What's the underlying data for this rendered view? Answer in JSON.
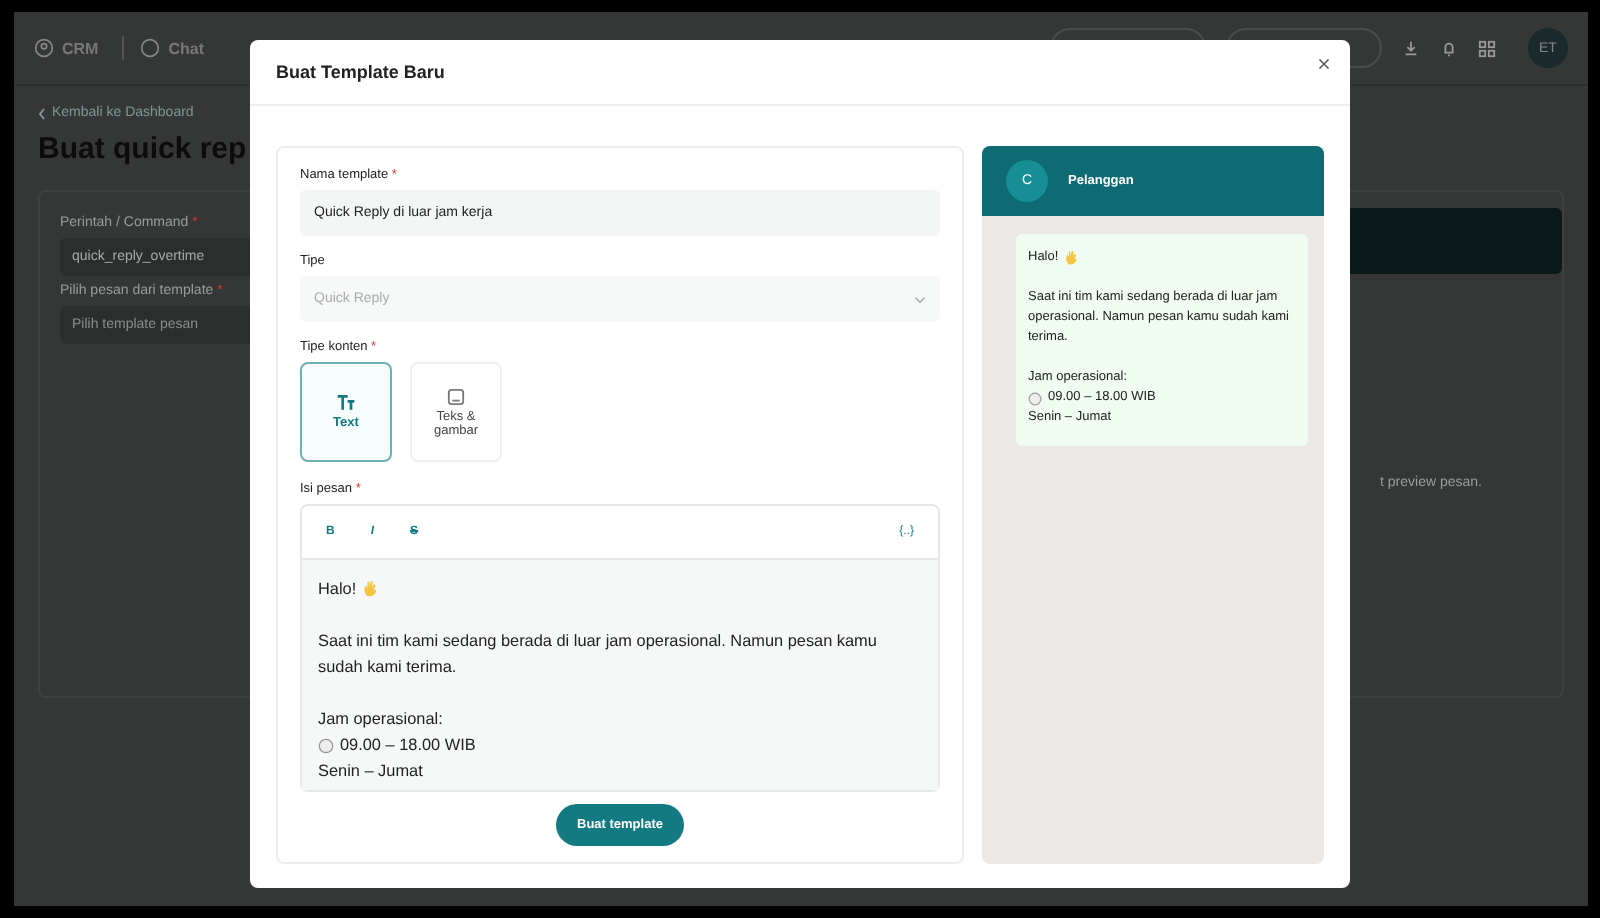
{
  "background": {
    "header": {
      "logos": [
        "CRM",
        "Chat"
      ],
      "avatar": "ET"
    },
    "back_link": "Kembali ke Dashboard",
    "title": "Buat quick rep",
    "fields": [
      {
        "label": "Perintah / Command",
        "required_mark": "*",
        "value": "quick_reply_overtime"
      },
      {
        "label": "Pilih pesan dari template",
        "required_mark": "*",
        "placeholder": "Pilih template pesan"
      }
    ],
    "preview_hint": "t preview pesan."
  },
  "modal": {
    "title": "Buat Template Baru",
    "name_field": {
      "label": "Nama template",
      "required_mark": "*",
      "value": "Quick Reply di luar jam kerja"
    },
    "type_field": {
      "label": "Tipe",
      "placeholder": "Quick Reply",
      "disabled": true
    },
    "content_type": {
      "label": "Tipe konten",
      "required_mark": "*",
      "options": [
        {
          "kind": "text",
          "label": "Text",
          "selected": true
        },
        {
          "kind": "image",
          "label": "Teks & gambar",
          "selected": false
        }
      ]
    },
    "message": {
      "label": "Isi pesan",
      "required_mark": "*",
      "toolbar": [
        {
          "kind": "bold",
          "label": "B"
        },
        {
          "kind": "italic",
          "label": "I"
        },
        {
          "kind": "strike",
          "label": "S"
        },
        {
          "kind": "variable",
          "label": "{..}"
        }
      ],
      "paragraphs": [
        [
          {
            "kind": "wave",
            "text": "Halo!"
          }
        ],
        [
          {
            "kind": "plain",
            "text": "Saat ini tim kami sedang berada di luar jam operasional. Namun pesan kamu sudah kami terima."
          }
        ],
        [
          {
            "kind": "plain",
            "text": "Jam operasional:"
          },
          {
            "kind": "clock",
            "text": "09.00 – 18.00 WIB"
          },
          {
            "kind": "plain",
            "text": "Senin – Jumat"
          }
        ]
      ]
    },
    "submit": "Buat template",
    "preview": {
      "avatar": "C",
      "name": "Pelanggan",
      "paragraphs": [
        [
          {
            "kind": "wave",
            "text": "Halo!"
          }
        ],
        [
          {
            "kind": "plain",
            "text": "Saat ini tim kami sedang berada di luar jam operasional. Namun pesan kamu sudah kami terima."
          }
        ],
        [
          {
            "kind": "plain",
            "text": "Jam operasional:"
          },
          {
            "kind": "clock",
            "text": "09.00 – 18.00 WIB"
          },
          {
            "kind": "plain",
            "text": "Senin – Jumat"
          }
        ]
      ]
    }
  }
}
